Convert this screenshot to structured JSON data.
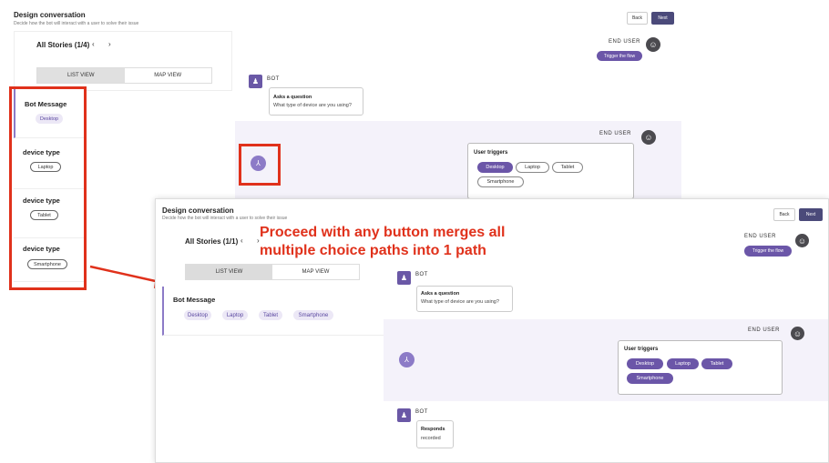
{
  "screen1": {
    "title": "Design conversation",
    "subtitle": "Decide how the bot will interact with a user to solve their issue",
    "back_label": "Back",
    "next_label": "Next",
    "stories_label": "All Stories (1/4)",
    "prev_icon": "‹",
    "next_icon": "›",
    "tabs": [
      "LIST VIEW",
      "MAP VIEW"
    ],
    "end_user_label": "END USER",
    "trigger_label": "Trigger the flow",
    "bot_label": "BOT",
    "bot_card_title": "Asks a question",
    "bot_card_body": "What type of device are you using?",
    "user_triggers_title": "User triggers",
    "options": [
      "Desktop",
      "Laptop",
      "Tablet",
      "Smartphone"
    ]
  },
  "list_view": {
    "items": [
      {
        "title": "Bot Message",
        "pill": "Desktop"
      },
      {
        "title": "device type",
        "pill": "Laptop"
      },
      {
        "title": "device type",
        "pill": "Tablet"
      },
      {
        "title": "device type",
        "pill": "Smartphone"
      }
    ]
  },
  "annotation": {
    "line1": "Proceed with any button merges all",
    "line2": "multiple choice paths into 1 path"
  },
  "screen2": {
    "title": "Design conversation",
    "subtitle": "Decide how the bot will interact with a user to solve their issue",
    "back_label": "Back",
    "next_label": "Next",
    "stories_label": "All Stories (1/1)",
    "prev_icon": "‹",
    "next_icon": "›",
    "tabs": [
      "LIST VIEW",
      "MAP VIEW"
    ],
    "bot_message_title": "Bot Message",
    "bot_message_options": [
      "Desktop",
      "Laptop",
      "Tablet",
      "Smartphone"
    ],
    "end_user_label": "END USER",
    "trigger_label": "Trigger the flow",
    "bot_label": "BOT",
    "bot_card_title": "Asks a question",
    "bot_card_body": "What type of device are you using?",
    "end_user_label2": "END USER",
    "user_triggers_title": "User triggers",
    "options": [
      "Desktop",
      "Laptop",
      "Tablet",
      "Smartphone"
    ],
    "bot_label2": "BOT",
    "responds_title": "Responds",
    "responds_body": "recorded"
  },
  "colors": {
    "accent": "#6b56a8",
    "annotation_red": "#e0311b",
    "next_button": "#4b4a7a"
  }
}
